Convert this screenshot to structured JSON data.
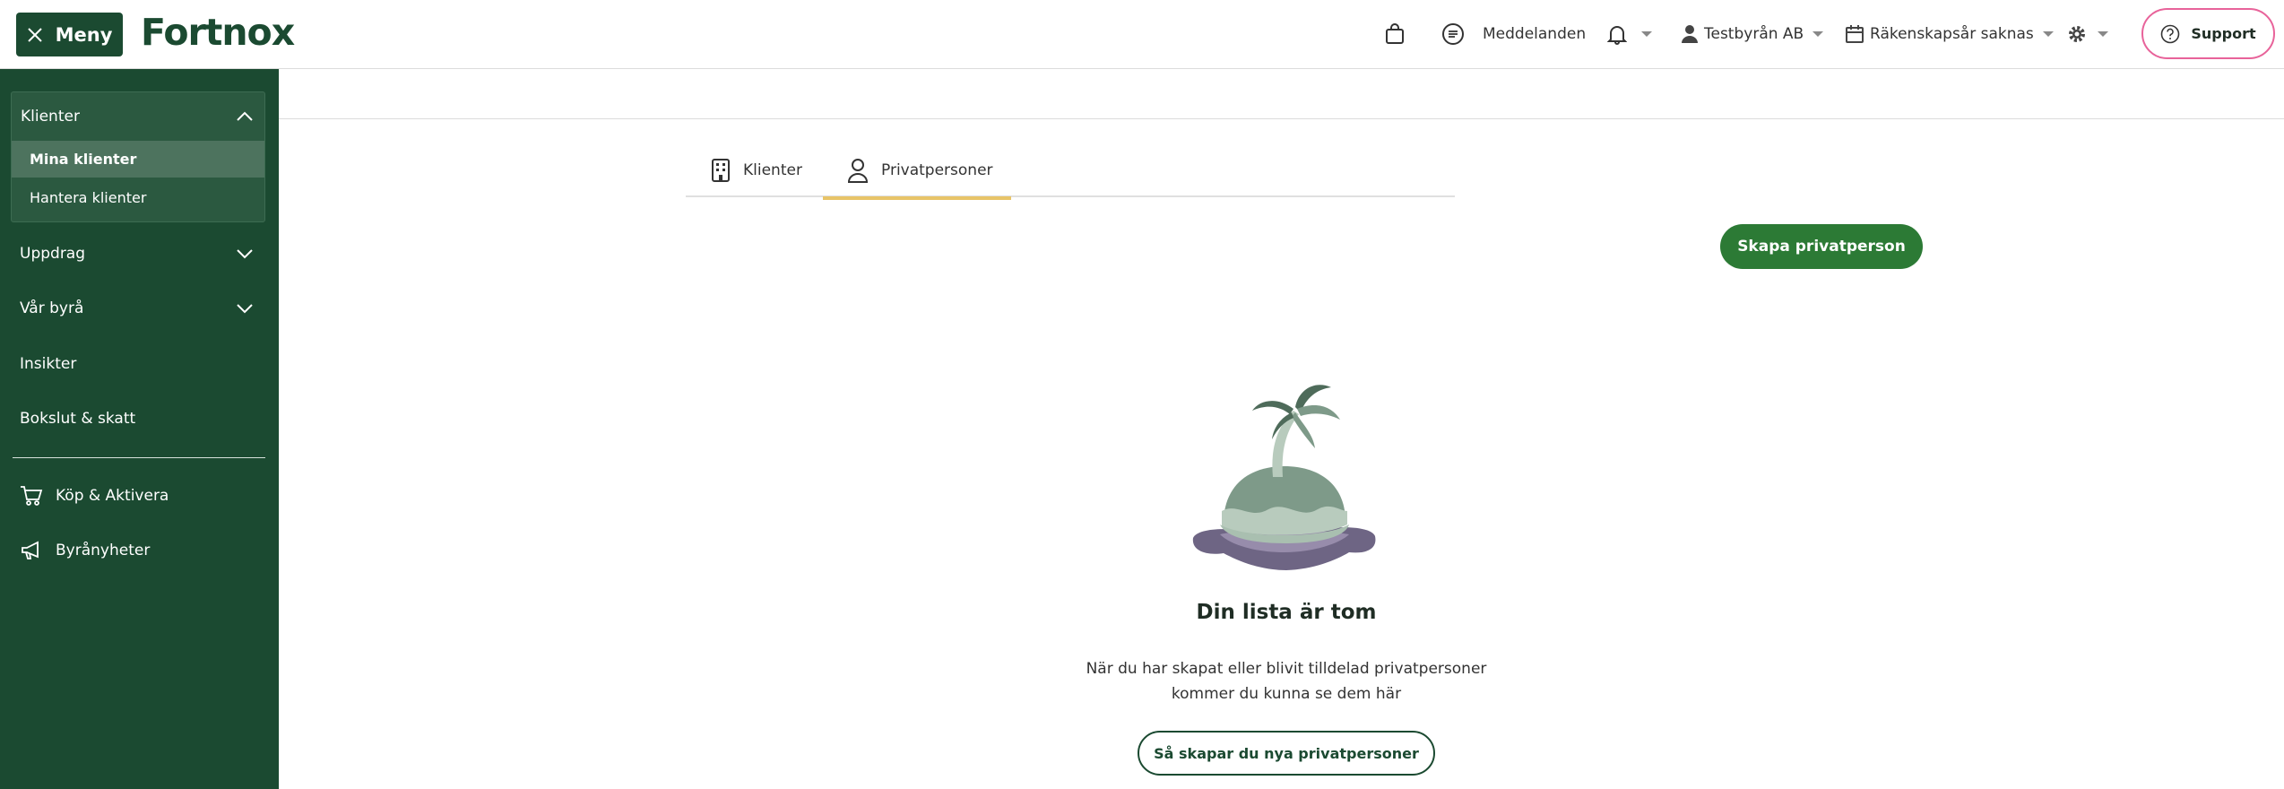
{
  "topbar": {
    "menu_label": "Meny",
    "logo_text": "Fortnox",
    "messages_label": "Meddelanden",
    "company_label": "Testbyrån AB",
    "fiscal_year_label": "Räkenskapsår saknas",
    "support_label": "Support"
  },
  "sidebar": {
    "group": {
      "label": "Klienter",
      "items": [
        {
          "label": "Mina klienter"
        },
        {
          "label": "Hantera klienter"
        }
      ]
    },
    "items": [
      {
        "label": "Uppdrag"
      },
      {
        "label": "Vår byrå"
      },
      {
        "label": "Insikter"
      },
      {
        "label": "Bokslut & skatt"
      }
    ],
    "links": [
      {
        "label": "Köp & Aktivera",
        "icon": "cart-icon"
      },
      {
        "label": "Byrånyheter",
        "icon": "megaphone-icon"
      }
    ]
  },
  "tabs": [
    {
      "label": "Klienter",
      "icon": "building-icon"
    },
    {
      "label": "Privatpersoner",
      "icon": "person-icon"
    }
  ],
  "main": {
    "create_button": "Skapa privatperson",
    "empty_title": "Din lista är tom",
    "empty_text_line1": "När du har skapat eller blivit tilldelad privatpersoner",
    "empty_text_line2": "kommer du kunna se dem här",
    "help_button": "Så skapar du nya privatpersoner"
  },
  "colors": {
    "brand_green": "#1b4a31",
    "button_green": "#2c7a35",
    "tab_underline": "#e8c468",
    "support_border": "#e8639a"
  }
}
